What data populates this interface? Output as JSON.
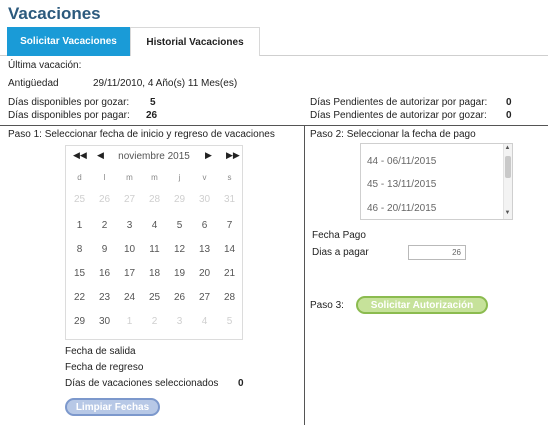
{
  "page_title": "Vacaciones",
  "tabs": [
    {
      "label": "Solicitar Vacaciones",
      "active": true
    },
    {
      "label": "Historial Vacaciones",
      "active": false
    }
  ],
  "info": {
    "ultima_vacacion_label": "Última vacación:",
    "antiguedad_label": "Antigüedad",
    "antiguedad_value": "29/11/2010, 4 Año(s) 11 Mes(es)",
    "dias_gozar_label": "Días disponibles por gozar:",
    "dias_gozar_value": "5",
    "dias_pagar_label": "Días disponibles por pagar:",
    "dias_pagar_value": "26",
    "pend_gozar_label": "Días Pendientes de autorizar por pagar:",
    "pend_gozar_value": "0",
    "pend_pagar_label": "Días Pendientes de autorizar por gozar:",
    "pend_pagar_value": "0"
  },
  "step1": {
    "label": "Paso 1: Seleccionar fecha de inicio y regreso de vacaciones",
    "calendar": {
      "prev_year_glyph": "◀◀",
      "prev_month_glyph": "◀",
      "next_month_glyph": "▶",
      "next_year_glyph": "▶▶",
      "month_label": "noviembre 2015",
      "weekdays": [
        "d",
        "l",
        "m",
        "m",
        "j",
        "v",
        "s"
      ],
      "weeks": [
        [
          "25",
          "26",
          "27",
          "28",
          "29",
          "30",
          "31"
        ],
        [
          "1",
          "2",
          "3",
          "4",
          "5",
          "6",
          "7"
        ],
        [
          "8",
          "9",
          "10",
          "11",
          "12",
          "13",
          "14"
        ],
        [
          "15",
          "16",
          "17",
          "18",
          "19",
          "20",
          "21"
        ],
        [
          "22",
          "23",
          "24",
          "25",
          "26",
          "27",
          "28"
        ],
        [
          "29",
          "30",
          "1",
          "2",
          "3",
          "4",
          "5"
        ]
      ]
    },
    "fecha_salida_label": "Fecha de salida",
    "fecha_regreso_label": "Fecha de regreso",
    "dias_seleccionados_label": "Días de vacaciones seleccionados",
    "dias_seleccionados_value": "0",
    "clear_button": "Limpiar Fechas"
  },
  "step2": {
    "label": "Paso 2: Seleccionar la fecha de pago",
    "pay_options": [
      "44 - 06/11/2015",
      "45 - 13/11/2015",
      "46 - 20/11/2015"
    ],
    "fecha_pago_label": "Fecha Pago",
    "dias_pagar_label": "Dias a pagar",
    "dias_pagar_value": "26"
  },
  "step3": {
    "label": "Paso 3:",
    "button": "Solicitar Autorización"
  },
  "colors": {
    "title": "#2c5a7d",
    "active_tab": "#1a9bd7",
    "auth_button": "#c6e29a",
    "clear_button": "#b7c8e6"
  }
}
